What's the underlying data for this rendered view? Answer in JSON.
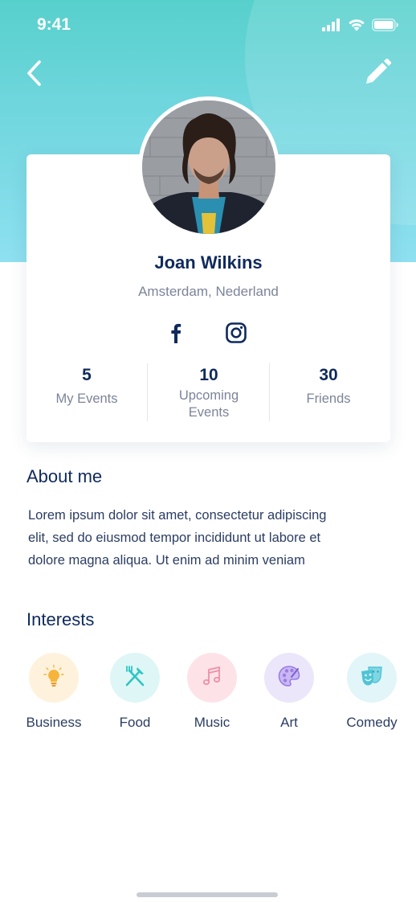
{
  "status_bar": {
    "time": "9:41",
    "icons": [
      "signal-icon",
      "wifi-icon",
      "battery-icon"
    ]
  },
  "nav": {
    "back_icon": "chevron-left-icon",
    "edit_icon": "pencil-icon"
  },
  "profile": {
    "name": "Joan Wilkins",
    "location": "Amsterdam, Nederland",
    "social": [
      "facebook-icon",
      "instagram-icon"
    ],
    "stats": [
      {
        "value": "5",
        "label": "My Events"
      },
      {
        "value": "10",
        "label_line1": "Upcoming",
        "label_line2": "Events"
      },
      {
        "value": "30",
        "label": "Friends"
      }
    ]
  },
  "about": {
    "title": "About me",
    "line1": "Lorem ipsum dolor sit amet, consectetur adipiscing",
    "line2": "elit, sed do eiusmod tempor incididunt ut labore et",
    "line3": "dolore magna aliqua. Ut enim ad minim veniam"
  },
  "interests": {
    "title": "Interests",
    "items": [
      {
        "label": "Business",
        "icon": "lightbulb-icon",
        "bg": "#fff2dd",
        "color": "#f5b53c"
      },
      {
        "label": "Food",
        "icon": "fork-knife-icon",
        "bg": "#dff6f7",
        "color": "#2fc6c2"
      },
      {
        "label": "Music",
        "icon": "music-note-icon",
        "bg": "#fde3e8",
        "color": "#ef8fa6"
      },
      {
        "label": "Art",
        "icon": "palette-icon",
        "bg": "#ece6fb",
        "color": "#9a7de3"
      },
      {
        "label": "Comedy",
        "icon": "theater-masks-icon",
        "bg": "#e2f5f8",
        "color": "#4fc4d6"
      }
    ]
  },
  "colors": {
    "header_gradient_top": "#57d0cc",
    "header_gradient_bottom": "#8ee0f0",
    "primary_text": "#0f2a5c",
    "secondary_text": "#7c849a"
  }
}
